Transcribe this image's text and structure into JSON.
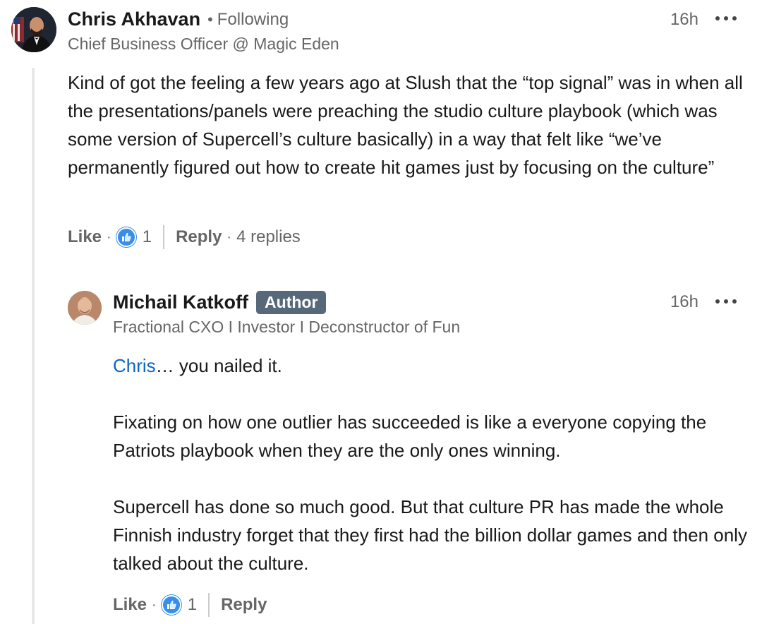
{
  "comments": [
    {
      "author": "Chris Akhavan",
      "following": "Following",
      "headline": "Chief Business Officer @ Magic Eden",
      "time": "16h",
      "text": "Kind of got the feeling a few years ago at Slush that the “top signal” was in when all the presentations/panels were preaching the studio culture playbook (which was some version of Supercell’s culture basically) in a way that felt like “we’ve permanently figured out how to create hit games just by focusing on the culture”",
      "like_label": "Like",
      "reaction_count": "1",
      "reply_label": "Reply",
      "replies_label": "4 replies"
    },
    {
      "author": "Michail Katkoff",
      "badge": "Author",
      "headline": "Fractional CXO I Investor I Deconstructor of Fun",
      "time": "16h",
      "mention": "Chris",
      "mention_tail": "… you nailed it.",
      "para2": "Fixating on how one outlier has succeeded is like a everyone copying the Patriots playbook when they are the only ones winning.",
      "para3": "Supercell has done so much good. But that culture PR has made the whole Finnish industry forget that they first had the billion dollar games and then only talked about the culture.",
      "like_label": "Like",
      "reaction_count": "1",
      "reply_label": "Reply"
    }
  ],
  "icons": {
    "like_reaction": "thumbs-up-icon",
    "more": "more-options-icon"
  },
  "colors": {
    "link": "#0a66c2",
    "badge_bg": "#56687a",
    "like_blue": "#378fe9",
    "muted_text": "#666666"
  }
}
